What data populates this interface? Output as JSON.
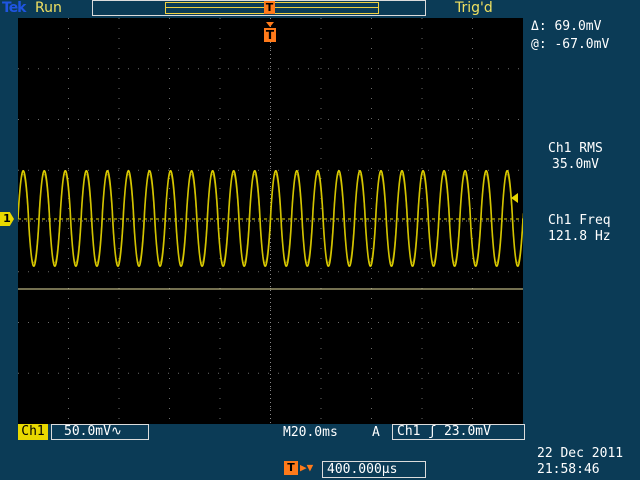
{
  "header": {
    "brand": "Tek",
    "acq_state": "Run",
    "trig_state": "Trig'd",
    "trigger_marker": "T"
  },
  "channel": {
    "marker": "1",
    "label": "Ch1",
    "scale": "50.0mV",
    "coupling_icon": "ac-coupling-icon",
    "color": "#e8d800"
  },
  "timebase": {
    "label": "M",
    "scale": "20.0ms"
  },
  "trigger": {
    "mode": "A",
    "source": "Ch1",
    "slope_icon": "rising-edge-icon",
    "level": "23.0mV",
    "position_marker": "T",
    "position": "400.000µs",
    "color": "#ff7a1a"
  },
  "cursor": {
    "delta_label": "Δ:",
    "delta_value": "69.0mV",
    "at_label": "@:",
    "at_value": "-67.0mV"
  },
  "measurements": [
    {
      "label": "Ch1 RMS",
      "value": "35.0mV"
    },
    {
      "label": "Ch1 Freq",
      "value": "121.8 Hz"
    }
  ],
  "datetime": {
    "date": "22 Dec 2011",
    "time": "21:58:46"
  },
  "chart_data": {
    "type": "line",
    "series": [
      {
        "waveform": "approximately sinusoidal",
        "frequency_hz": 121.8,
        "rms_mv": 35.0,
        "cycles_on_screen": 24
      }
    ],
    "x_range_ms": [
      -100,
      100
    ],
    "y_range_mv": [
      -200,
      200
    ],
    "grid": "on",
    "cursor_levels_mv": [
      2.0,
      -67.0
    ]
  }
}
